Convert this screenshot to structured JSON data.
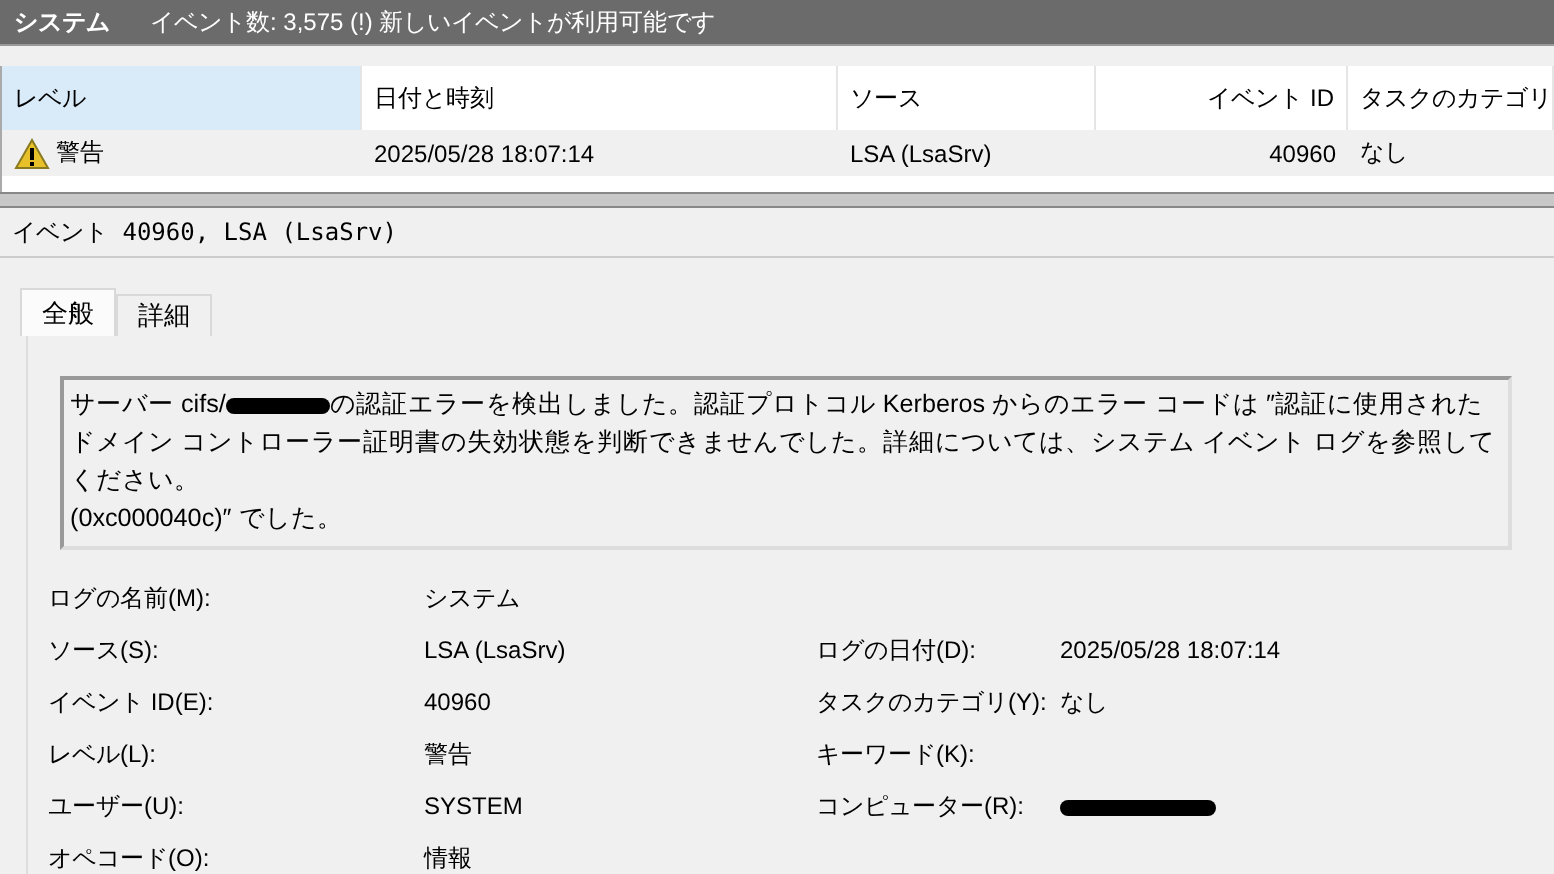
{
  "title_bar": {
    "log_name": "システム",
    "status": "イベント数: 3,575 (!) 新しいイベントが利用可能です"
  },
  "table": {
    "columns": [
      {
        "label": "レベル",
        "selected": true
      },
      {
        "label": "日付と時刻",
        "selected": false
      },
      {
        "label": "ソース",
        "selected": false
      },
      {
        "label": "イベント ID",
        "selected": false
      },
      {
        "label": "タスクのカテゴリ",
        "selected": false
      }
    ],
    "rows": [
      {
        "kind": "warning",
        "selected": true,
        "cells": [
          "警告",
          "2025/05/28 18:07:14",
          "LSA (LsaSrv)",
          "40960",
          "なし"
        ]
      }
    ]
  },
  "event_header": "イベント 40960, LSA (LsaSrv)",
  "tabs": [
    {
      "label": "全般",
      "selected": true
    },
    {
      "label": "詳細",
      "selected": false
    }
  ],
  "message": {
    "before": "サーバー cifs/",
    "redacted": true,
    "after": "の認証エラーを検出しました。認証プロトコル Kerberos からのエラー コードは ″認証に使用されたドメイン コントローラー証明書の失効状態を判断できませんでした。詳細については、システム イベント ログを参照してください。\n(0xc000040c)″ でした。"
  },
  "fields": [
    {
      "left": {
        "label": "ログの名前(M):",
        "value": "システム"
      }
    },
    {
      "left": {
        "label": "ソース(S):",
        "value": "LSA (LsaSrv)"
      },
      "right": {
        "label": "ログの日付(D):",
        "value": "2025/05/28 18:07:14"
      }
    },
    {
      "left": {
        "label": "イベント ID(E):",
        "value": "40960"
      },
      "right": {
        "label": "タスクのカテゴリ(Y):",
        "value": "なし"
      }
    },
    {
      "left": {
        "label": "レベル(L):",
        "value": "警告"
      },
      "right": {
        "label": "キーワード(K):"
      }
    },
    {
      "left": {
        "label": "ユーザー(U):",
        "value": "SYSTEM"
      },
      "right": {
        "label": "コンピューター(R):",
        "redacted": true
      }
    },
    {
      "left": {
        "label": "オペコード(O):",
        "value": "情報"
      }
    }
  ]
}
